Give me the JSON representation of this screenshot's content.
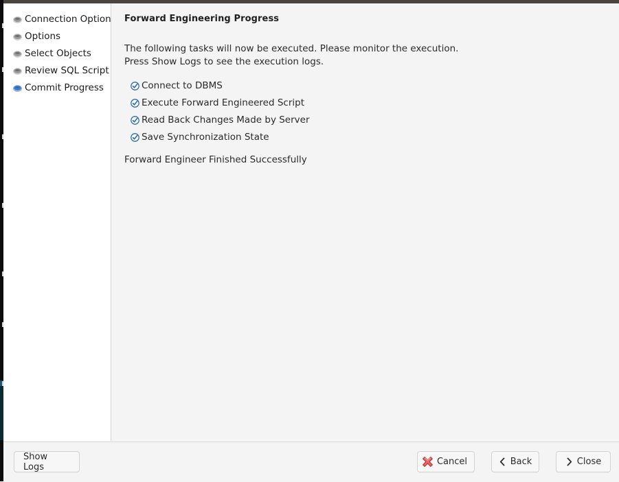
{
  "window": {
    "accent_color": "#3b82d4",
    "sidebar_bg": "#ffffff",
    "content_bg": "#f4f4f4",
    "danger_color": "#e03b3b"
  },
  "sidebar": {
    "items": [
      {
        "label": "Connection Options",
        "bullet": "radio-bullet",
        "active": false
      },
      {
        "label": "Options",
        "bullet": "radio-bullet",
        "active": false
      },
      {
        "label": "Select Objects",
        "bullet": "radio-bullet",
        "active": false
      },
      {
        "label": "Review SQL Script",
        "bullet": "radio-bullet",
        "active": false
      },
      {
        "label": "Commit Progress",
        "bullet": "radio-bullet",
        "active": true
      }
    ]
  },
  "main": {
    "title": "Forward Engineering Progress",
    "intro": "The following tasks will now be executed. Please monitor the execution.\nPress Show Logs to see the execution logs.",
    "tasks": [
      {
        "label": "Connect to DBMS",
        "icon": "check-circle-icon",
        "checked": true
      },
      {
        "label": "Execute Forward Engineered Script",
        "icon": "check-circle-icon",
        "checked": true
      },
      {
        "label": "Read Back Changes Made by Server",
        "icon": "check-circle-icon",
        "checked": true
      },
      {
        "label": "Save Synchronization State",
        "icon": "check-circle-icon",
        "checked": true
      }
    ],
    "status": "Forward Engineer Finished Successfully"
  },
  "footer": {
    "show_logs_label": "Show Logs",
    "cancel_label": "Cancel",
    "cancel_icon": "red-x-icon",
    "back_label": "Back",
    "back_icon": "chevron-left-icon",
    "close_label": "Close",
    "close_icon": "chevron-right-icon"
  }
}
